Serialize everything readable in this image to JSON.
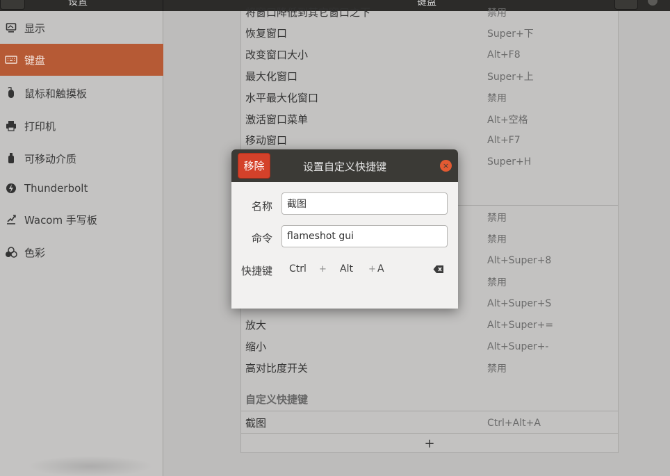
{
  "header": {
    "left_title": "设置",
    "center_title": "键盘"
  },
  "sidebar": {
    "items": [
      {
        "label": "显示",
        "icon": "display-icon"
      },
      {
        "label": "键盘",
        "icon": "keyboard-icon",
        "active": true
      },
      {
        "label": "鼠标和触摸板",
        "icon": "mouse-icon"
      },
      {
        "label": "打印机",
        "icon": "printer-icon"
      },
      {
        "label": "可移动介质",
        "icon": "usb-icon"
      },
      {
        "label": "Thunderbolt",
        "icon": "thunderbolt-icon"
      },
      {
        "label": "Wacom 手写板",
        "icon": "tablet-icon"
      },
      {
        "label": "色彩",
        "icon": "color-icon"
      }
    ]
  },
  "shortcuts": {
    "top_cut": {
      "name": "将窗口降低到其它窗口之下",
      "accel": "禁用"
    },
    "window_rows": [
      {
        "name": "恢复窗口",
        "accel": "Super+下"
      },
      {
        "name": "改变窗口大小",
        "accel": "Alt+F8"
      },
      {
        "name": "最大化窗口",
        "accel": "Super+上"
      },
      {
        "name": "水平最大化窗口",
        "accel": "禁用"
      },
      {
        "name": "激活窗口菜单",
        "accel": "Alt+空格"
      },
      {
        "name": "移动窗口",
        "accel": "Alt+F7"
      },
      {
        "name": "",
        "accel": "Super+H"
      }
    ],
    "access_rows": [
      {
        "name": "",
        "accel": "禁用"
      },
      {
        "name": "",
        "accel": "禁用"
      },
      {
        "name": "",
        "accel": "Alt+Super+8"
      },
      {
        "name": "",
        "accel": "禁用"
      },
      {
        "name": "",
        "accel": "Alt+Super+S"
      },
      {
        "name": "放大",
        "accel": "Alt+Super+="
      },
      {
        "name": "缩小",
        "accel": "Alt+Super+-"
      },
      {
        "name": "高对比度开关",
        "accel": "禁用"
      }
    ],
    "custom_section_title": "自定义快捷键",
    "custom_rows": [
      {
        "name": "截图",
        "accel": "Ctrl+Alt+A"
      }
    ],
    "add_label": "+"
  },
  "dialog": {
    "title": "设置自定义快捷键",
    "remove_label": "移除",
    "close_glyph": "×",
    "name_label": "名称",
    "name_value": "截图",
    "command_label": "命令",
    "command_value": "flameshot gui",
    "shortcut_label": "快捷键",
    "shortcut_keys": [
      "Ctrl",
      "Alt",
      "A"
    ],
    "plus_glyph": "+"
  }
}
